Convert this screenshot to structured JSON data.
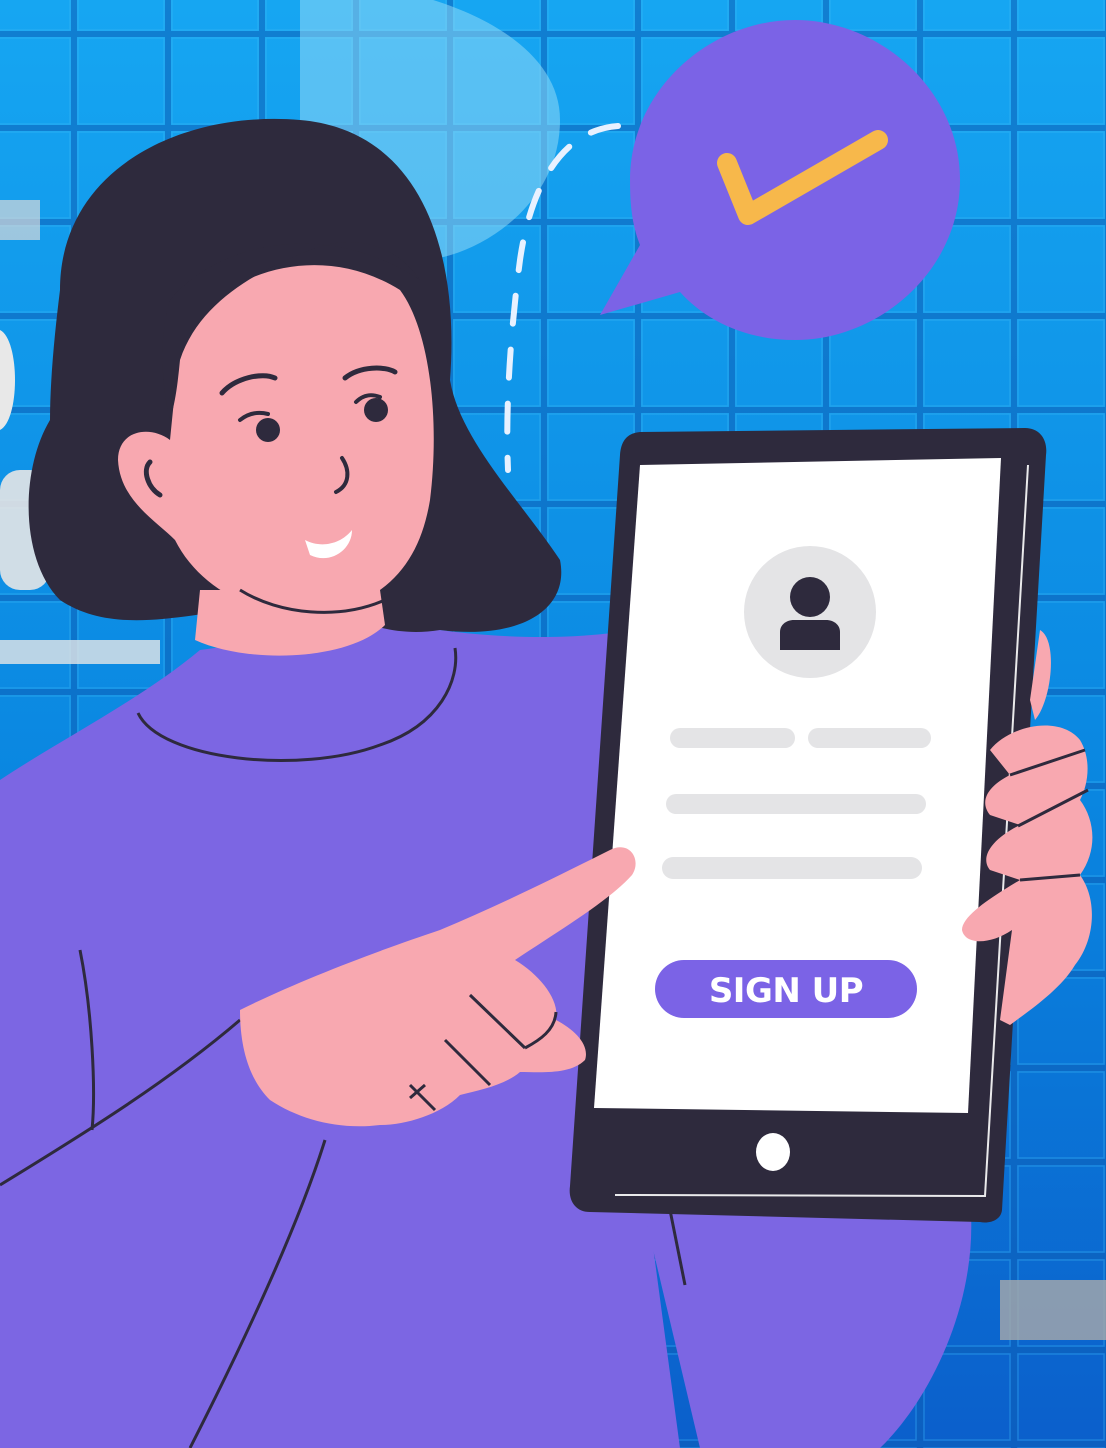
{
  "signup": {
    "button_label": "SIGN UP"
  },
  "colors": {
    "background": "#0a7fd8",
    "sweater": "#7c66e3",
    "skin": "#f8a8b0",
    "hair": "#2e2a3d",
    "tablet_frame": "#2e2a3d",
    "screen": "#ffffff",
    "placeholder_line": "#e4e4e6",
    "accent_purple": "#7b63e6",
    "check_yellow": "#f7b84b"
  },
  "icons": {
    "avatar": "user-avatar-icon",
    "check": "check-icon",
    "home": "home-button"
  }
}
